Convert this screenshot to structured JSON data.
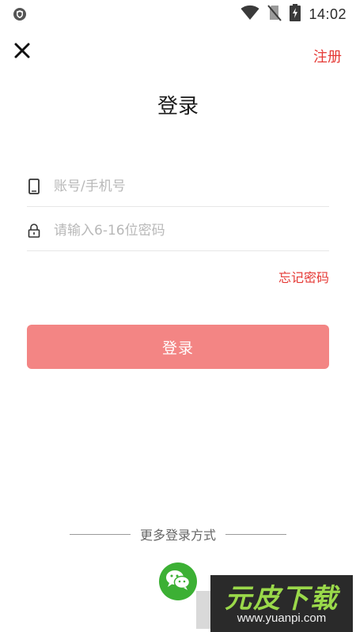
{
  "status_bar": {
    "time": "14:02",
    "icons": [
      "shield-icon",
      "wifi-icon",
      "no-sim-icon",
      "battery-charging-icon"
    ]
  },
  "header": {
    "close_icon": "close-icon",
    "register_label": "注册",
    "title": "登录"
  },
  "form": {
    "account": {
      "icon": "phone-icon",
      "placeholder": "账号/手机号",
      "value": ""
    },
    "password": {
      "icon": "lock-icon",
      "placeholder": "请输入6-16位密码",
      "value": ""
    },
    "forgot_label": "忘记密码",
    "login_label": "登录"
  },
  "alt_login": {
    "label": "更多登录方式",
    "wechat_icon": "wechat-icon"
  },
  "watermark": {
    "title": "元皮下载",
    "url": "www.yuanpi.com"
  },
  "colors": {
    "accent": "#e53935",
    "login_button": "#f38584",
    "wechat": "#3cb034"
  }
}
